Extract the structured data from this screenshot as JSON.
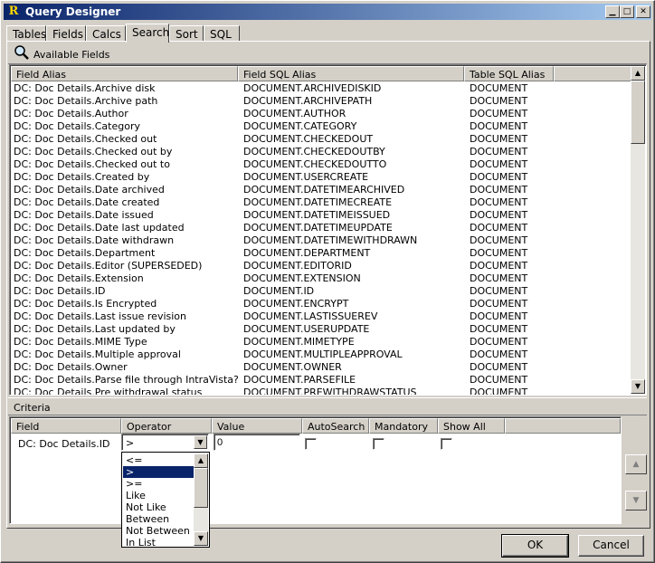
{
  "window": {
    "title": "Query Designer",
    "app_icon": "R"
  },
  "tabs": [
    {
      "label": "Tables"
    },
    {
      "label": "Fields"
    },
    {
      "label": "Calcs"
    },
    {
      "label": "Search"
    },
    {
      "label": "Sort"
    },
    {
      "label": "SQL"
    }
  ],
  "active_tab": "Search",
  "available_fields": {
    "header": "Available Fields",
    "columns": [
      "Field Alias",
      "Field SQL Alias",
      "Table SQL Alias"
    ],
    "rows": [
      [
        "DC: Doc Details.Archive disk",
        "DOCUMENT.ARCHIVEDISKID",
        "DOCUMENT"
      ],
      [
        "DC: Doc Details.Archive path",
        "DOCUMENT.ARCHIVEPATH",
        "DOCUMENT"
      ],
      [
        "DC: Doc Details.Author",
        "DOCUMENT.AUTHOR",
        "DOCUMENT"
      ],
      [
        "DC: Doc Details.Category",
        "DOCUMENT.CATEGORY",
        "DOCUMENT"
      ],
      [
        "DC: Doc Details.Checked out",
        "DOCUMENT.CHECKEDOUT",
        "DOCUMENT"
      ],
      [
        "DC: Doc Details.Checked out by",
        "DOCUMENT.CHECKEDOUTBY",
        "DOCUMENT"
      ],
      [
        "DC: Doc Details.Checked out to",
        "DOCUMENT.CHECKEDOUTTO",
        "DOCUMENT"
      ],
      [
        "DC: Doc Details.Created by",
        "DOCUMENT.USERCREATE",
        "DOCUMENT"
      ],
      [
        "DC: Doc Details.Date archived",
        "DOCUMENT.DATETIMEARCHIVED",
        "DOCUMENT"
      ],
      [
        "DC: Doc Details.Date created",
        "DOCUMENT.DATETIMECREATE",
        "DOCUMENT"
      ],
      [
        "DC: Doc Details.Date issued",
        "DOCUMENT.DATETIMEISSUED",
        "DOCUMENT"
      ],
      [
        "DC: Doc Details.Date last updated",
        "DOCUMENT.DATETIMEUPDATE",
        "DOCUMENT"
      ],
      [
        "DC: Doc Details.Date withdrawn",
        "DOCUMENT.DATETIMEWITHDRAWN",
        "DOCUMENT"
      ],
      [
        "DC: Doc Details.Department",
        "DOCUMENT.DEPARTMENT",
        "DOCUMENT"
      ],
      [
        "DC: Doc Details.Editor (SUPERSEDED)",
        "DOCUMENT.EDITORID",
        "DOCUMENT"
      ],
      [
        "DC: Doc Details.Extension",
        "DOCUMENT.EXTENSION",
        "DOCUMENT"
      ],
      [
        "DC: Doc Details.ID",
        "DOCUMENT.ID",
        "DOCUMENT"
      ],
      [
        "DC: Doc Details.Is Encrypted",
        "DOCUMENT.ENCRYPT",
        "DOCUMENT"
      ],
      [
        "DC: Doc Details.Last issue revision",
        "DOCUMENT.LASTISSUEREV",
        "DOCUMENT"
      ],
      [
        "DC: Doc Details.Last updated by",
        "DOCUMENT.USERUPDATE",
        "DOCUMENT"
      ],
      [
        "DC: Doc Details.MIME Type",
        "DOCUMENT.MIMETYPE",
        "DOCUMENT"
      ],
      [
        "DC: Doc Details.Multiple approval",
        "DOCUMENT.MULTIPLEAPPROVAL",
        "DOCUMENT"
      ],
      [
        "DC: Doc Details.Owner",
        "DOCUMENT.OWNER",
        "DOCUMENT"
      ],
      [
        "DC: Doc Details.Parse file through IntraVista?",
        "DOCUMENT.PARSEFILE",
        "DOCUMENT"
      ],
      [
        "DC: Doc Details.Pre withdrawal status",
        "DOCUMENT.PREWITHDRAWSTATUS",
        "DOCUMENT"
      ]
    ]
  },
  "criteria": {
    "header": "Criteria",
    "columns": [
      "Field",
      "Operator",
      "Value",
      "AutoSearch",
      "Mandatory",
      "Show All"
    ],
    "row": {
      "field": "DC: Doc Details.ID",
      "operator": ">",
      "value": "0",
      "autosearch": false,
      "mandatory": false,
      "show_all": false
    },
    "operator_options": [
      "<=",
      ">",
      ">=",
      "Like",
      "Not Like",
      "Between",
      "Not Between",
      "In List"
    ],
    "selected_operator_index": 1
  },
  "buttons": {
    "ok": "OK",
    "cancel": "Cancel"
  },
  "icons": {
    "search": "magnifier-icon",
    "move_up": "arrow-up-icon",
    "move_down": "arrow-down-icon"
  }
}
